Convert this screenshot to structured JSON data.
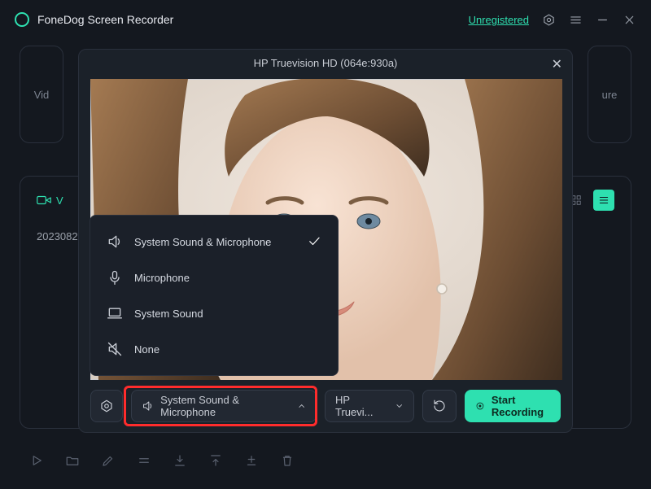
{
  "app": {
    "title": "FoneDog Screen Recorder",
    "unregistered": "Unregistered"
  },
  "bg": {
    "tile_left": "Vid",
    "tile_right": "ure",
    "tab_label": "V",
    "date": "2023082"
  },
  "modal": {
    "title": "HP Truevision HD (064e:930a)",
    "audio_button": "System Sound & Microphone",
    "camera_button": "HP Truevi...",
    "start_button": "Start Recording"
  },
  "dropdown": {
    "items": [
      {
        "label": "System Sound & Microphone",
        "icon": "speaker",
        "selected": true
      },
      {
        "label": "Microphone",
        "icon": "mic",
        "selected": false
      },
      {
        "label": "System Sound",
        "icon": "laptop",
        "selected": false
      },
      {
        "label": "None",
        "icon": "mute",
        "selected": false
      }
    ]
  }
}
